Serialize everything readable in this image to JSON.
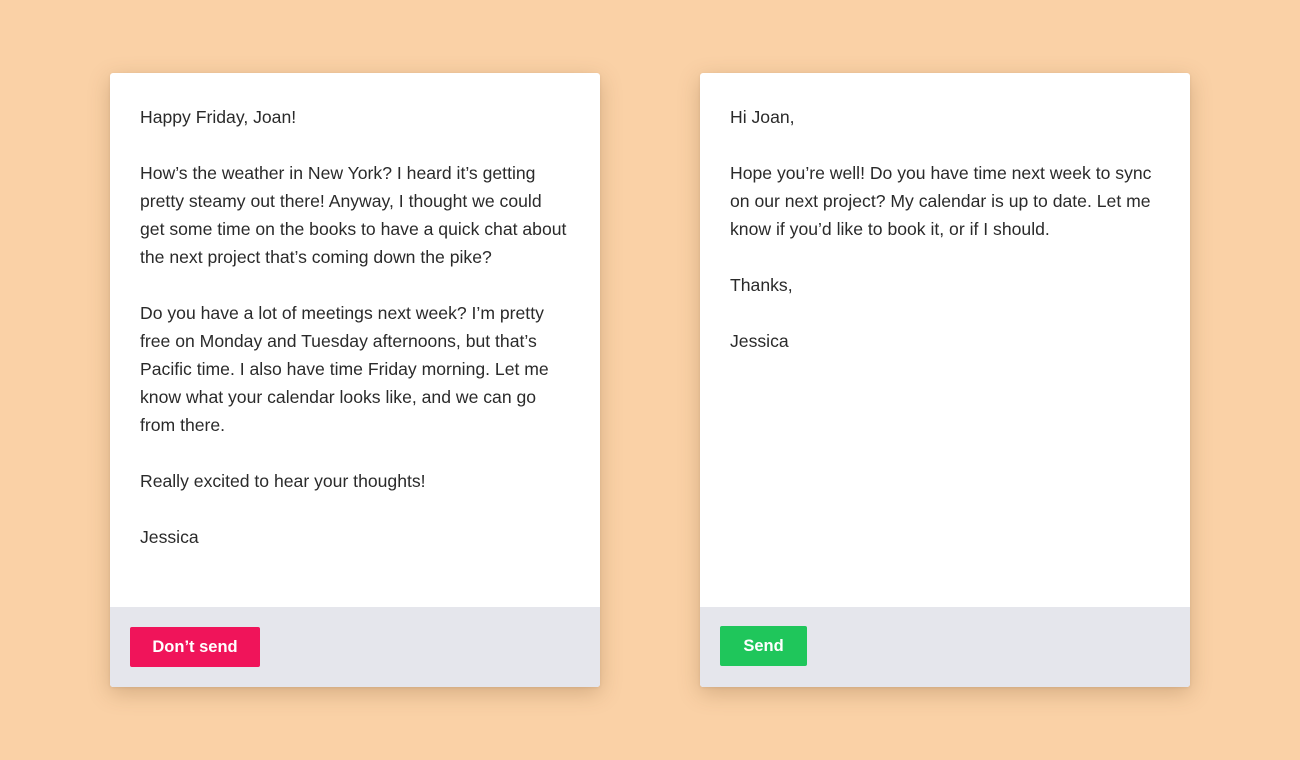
{
  "colors": {
    "background": "#fad1a6",
    "card": "#ffffff",
    "footer": "#e5e6ec",
    "text": "#2a2a2a",
    "dont_send_button": "#f0145a",
    "send_button": "#1fc65b"
  },
  "left_email": {
    "greeting": "Happy Friday, Joan!",
    "paragraph_1": "How’s the weather in New York? I heard it’s getting pretty steamy out there! Anyway, I thought we could get some time on the books to have a quick chat about the next project that’s coming down the pike?",
    "paragraph_2": "Do you have a lot of meetings next week? I’m pretty free on Monday and Tuesday afternoons, but that’s Pacific time. I also have time Friday morning. Let me know what your calendar looks like, and we can go from there.",
    "paragraph_3": "Really excited to hear your thoughts!",
    "signature": "Jessica",
    "button_label": "Don’t send"
  },
  "right_email": {
    "greeting": "Hi Joan,",
    "paragraph_1": "Hope you’re well! Do you have time next week to sync on our next project? My calendar is up to date. Let me know if you’d like to book it, or if I should.",
    "closing": "Thanks,",
    "signature": "Jessica",
    "button_label": "Send"
  }
}
